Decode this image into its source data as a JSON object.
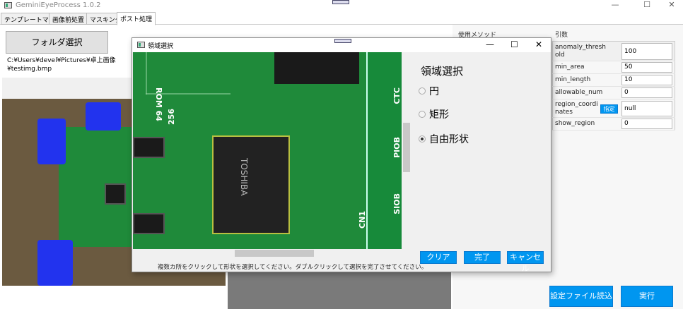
{
  "window": {
    "title": "GeminiEyeProcess 1.0.2",
    "minimize": "—",
    "maximize": "☐",
    "close": "✕"
  },
  "tabs": [
    {
      "label": "テンプレートマッチ"
    },
    {
      "label": "画像前処置"
    },
    {
      "label": "マスキング"
    },
    {
      "label": "ポスト処理",
      "active": true
    }
  ],
  "left": {
    "folder_button": "フォルダ選択",
    "path_line1": "C:¥Users¥devel¥Pictures¥卓上画像",
    "path_line2": "¥testimg.bmp"
  },
  "right": {
    "method_header": "使用メソッド",
    "args_header": "引数",
    "args": [
      {
        "name": "anomaly_threshold",
        "value": "100"
      },
      {
        "name": "min_area",
        "value": "50"
      },
      {
        "name": "min_length",
        "value": "10"
      },
      {
        "name": "allowable_num",
        "value": "0"
      },
      {
        "name": "region_coordinates",
        "value": "null",
        "button": "指定"
      },
      {
        "name": "show_region",
        "value": "0"
      }
    ],
    "load_button": "設定ファイル読込",
    "run_button": "実行"
  },
  "dialog": {
    "title": "領域選択",
    "heading": "領域選択",
    "options": [
      {
        "label": "円",
        "checked": false
      },
      {
        "label": "矩形",
        "checked": false
      },
      {
        "label": "自由形状",
        "checked": true
      }
    ],
    "clear_button": "クリア",
    "done_button": "完了",
    "cancel_button": "キャンセル",
    "instruction": "複数カ所をクリックして形状を選択してください。ダブルクリックして選択を完了させてください。",
    "board_labels": [
      "ROM 64",
      "256",
      "TOSHIBA",
      "CTC",
      "PIOB",
      "SIOB",
      "CN1"
    ]
  },
  "colors": {
    "accent": "#0096f0",
    "pcb": "#1f8a3a"
  }
}
